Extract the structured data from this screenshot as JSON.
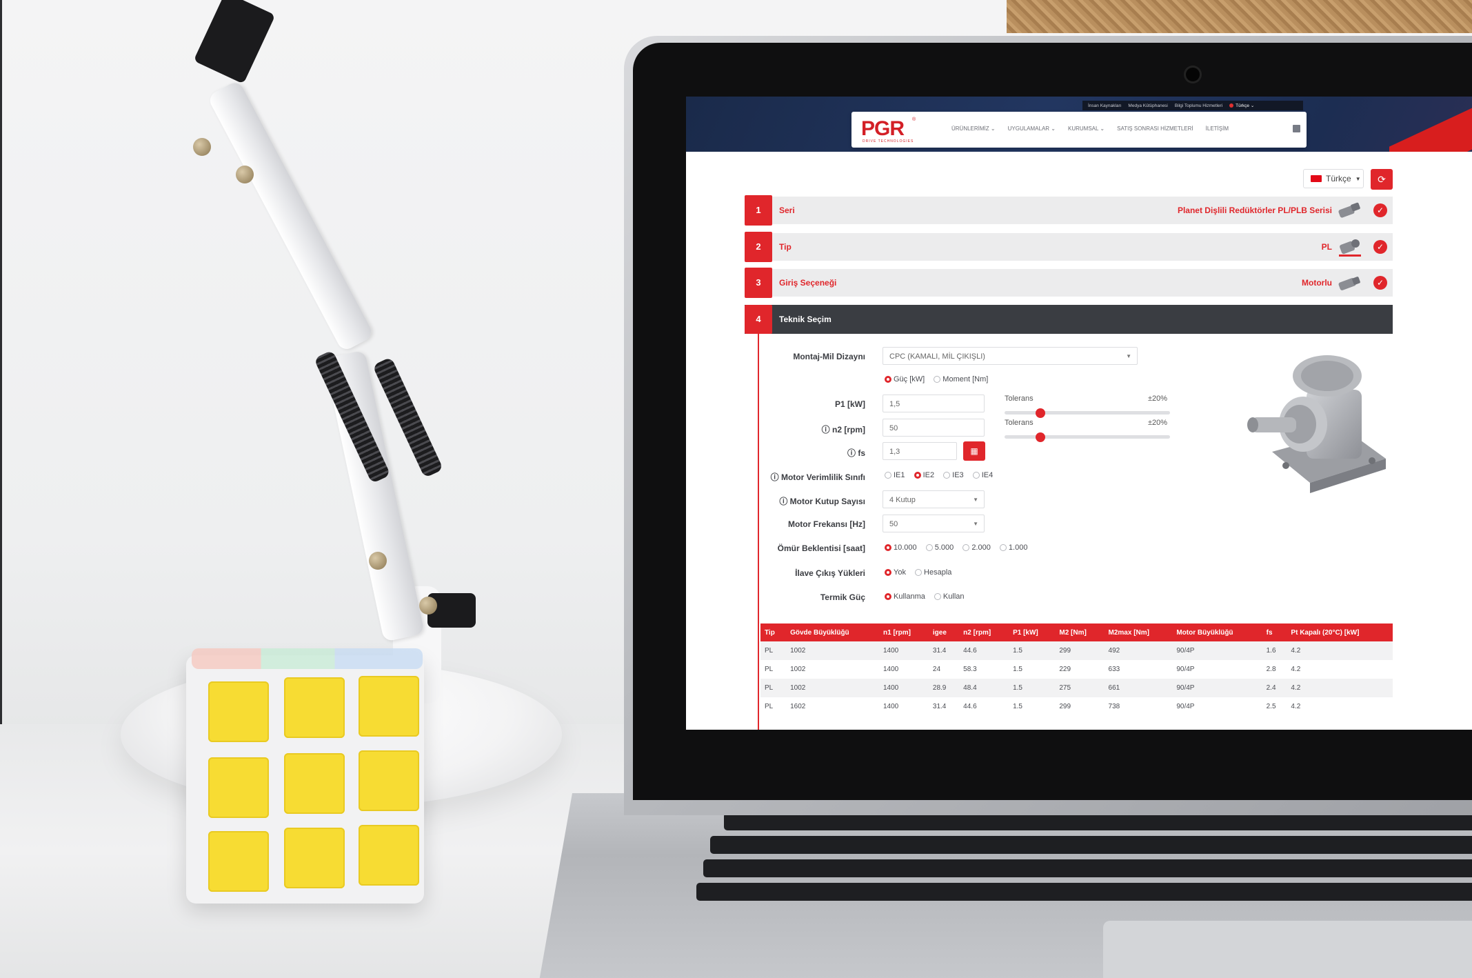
{
  "site": {
    "topbar": {
      "links": [
        "İnsan Kaynakları",
        "Medya Kütüphanesi",
        "Bilgi Toplumu Hizmetleri"
      ],
      "language": "Türkçe"
    },
    "logo": {
      "text": "PGR",
      "registered": "®",
      "subtitle": "DRIVE TECHNOLOGIES"
    },
    "nav": [
      "ÜRÜNLERİMİZ",
      "UYGULAMALAR",
      "KURUMSAL",
      "SATIŞ SONRASI HİZMETLERİ",
      "İLETİŞİM"
    ]
  },
  "controls": {
    "language": "Türkçe",
    "refresh_icon": "refresh-icon"
  },
  "steps": [
    {
      "num": "1",
      "label": "Seri",
      "value": "Planet Dişlili Redüktörler PL/PLB Serisi"
    },
    {
      "num": "2",
      "label": "Tip",
      "value": "PL"
    },
    {
      "num": "3",
      "label": "Giriş Seçeneği",
      "value": "Motorlu"
    },
    {
      "num": "4",
      "label": "Teknik Seçim"
    }
  ],
  "form": {
    "montaj": {
      "label": "Montaj-Mil Dizaynı",
      "value": "CPC (KAMALI, MİL ÇIKIŞLI)"
    },
    "mode": {
      "options": [
        "Güç [kW]",
        "Moment [Nm]"
      ],
      "selected": "Güç [kW]"
    },
    "p1": {
      "label": "P1 [kW]",
      "value": "1,5",
      "tolerance_label": "Tolerans",
      "tolerance": "±20%"
    },
    "n2": {
      "label": "n2 [rpm]",
      "value": "50",
      "tolerance_label": "Tolerans",
      "tolerance": "±20%"
    },
    "fs": {
      "label": "fs",
      "value": "1,3"
    },
    "efficiency": {
      "label": "Motor Verimlilik Sınıfı",
      "options": [
        "IE1",
        "IE2",
        "IE3",
        "IE4"
      ],
      "selected": "IE2"
    },
    "poles": {
      "label": "Motor Kutup Sayısı",
      "value": "4 Kutup"
    },
    "frequency": {
      "label": "Motor Frekansı [Hz]",
      "value": "50"
    },
    "life": {
      "label": "Ömür Beklentisi [saat]",
      "options": [
        "10.000",
        "5.000",
        "2.000",
        "1.000"
      ],
      "selected": "10.000"
    },
    "loads": {
      "label": "İlave Çıkış Yükleri",
      "options": [
        "Yok",
        "Hesapla"
      ],
      "selected": "Yok"
    },
    "thermal": {
      "label": "Termik Güç",
      "options": [
        "Kullanma",
        "Kullan"
      ],
      "selected": "Kullanma"
    }
  },
  "results": {
    "columns": [
      "Tip",
      "Gövde Büyüklüğü",
      "n1 [rpm]",
      "igee",
      "n2 [rpm]",
      "P1 [kW]",
      "M2 [Nm]",
      "M2max [Nm]",
      "Motor Büyüklüğü",
      "fs",
      "Pt Kapalı (20°C) [kW]"
    ],
    "rows": [
      [
        "PL",
        "1002",
        "1400",
        "31.4",
        "44.6",
        "1.5",
        "299",
        "492",
        "90/4P",
        "1.6",
        "4.2"
      ],
      [
        "PL",
        "1002",
        "1400",
        "24",
        "58.3",
        "1.5",
        "229",
        "633",
        "90/4P",
        "2.8",
        "4.2"
      ],
      [
        "PL",
        "1002",
        "1400",
        "28.9",
        "48.4",
        "1.5",
        "275",
        "661",
        "90/4P",
        "2.4",
        "4.2"
      ],
      [
        "PL",
        "1602",
        "1400",
        "31.4",
        "44.6",
        "1.5",
        "299",
        "738",
        "90/4P",
        "2.5",
        "4.2"
      ]
    ]
  },
  "colors": {
    "accent": "#e0262b",
    "header": "#1c2d52",
    "dark_bar": "#3a3d42"
  }
}
